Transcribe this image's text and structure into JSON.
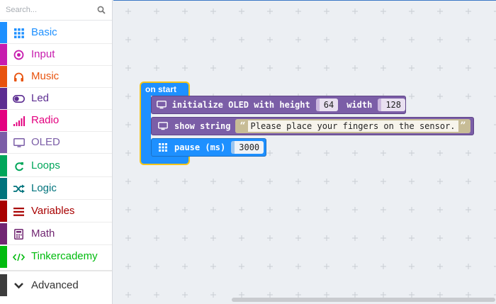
{
  "search": {
    "placeholder": "Search..."
  },
  "toolbox": {
    "categories": [
      {
        "label": "Basic",
        "color": "#1e90ff",
        "icon": "grid-icon"
      },
      {
        "label": "Input",
        "color": "#c71cae",
        "icon": "target-icon"
      },
      {
        "label": "Music",
        "color": "#e8530e",
        "icon": "headphones-icon"
      },
      {
        "label": "Led",
        "color": "#5c2d91",
        "icon": "toggle-icon"
      },
      {
        "label": "Radio",
        "color": "#e3007f",
        "icon": "signal-bars-icon"
      },
      {
        "label": "OLED",
        "color": "#7b5ea7",
        "icon": "monitor-icon"
      },
      {
        "label": "Loops",
        "color": "#00a65a",
        "icon": "refresh-icon"
      },
      {
        "label": "Logic",
        "color": "#00737c",
        "icon": "shuffle-icon"
      },
      {
        "label": "Variables",
        "color": "#a80000",
        "icon": "list-icon"
      },
      {
        "label": "Math",
        "color": "#712672",
        "icon": "calculator-icon"
      },
      {
        "label": "Tinkercademy",
        "color": "#00bb0e",
        "icon": "code-icon"
      }
    ],
    "advanced": {
      "label": "Advanced",
      "icon": "chevron-down-icon"
    }
  },
  "blocks": {
    "on_start": "on start",
    "init_oled": {
      "text": "initialize OLED with height",
      "height": "64",
      "width_label": "width",
      "width": "128"
    },
    "show_string": {
      "text": "show string",
      "value": "Please place your fingers on the sensor."
    },
    "pause": {
      "text": "pause (ms)",
      "value": "3000"
    }
  }
}
